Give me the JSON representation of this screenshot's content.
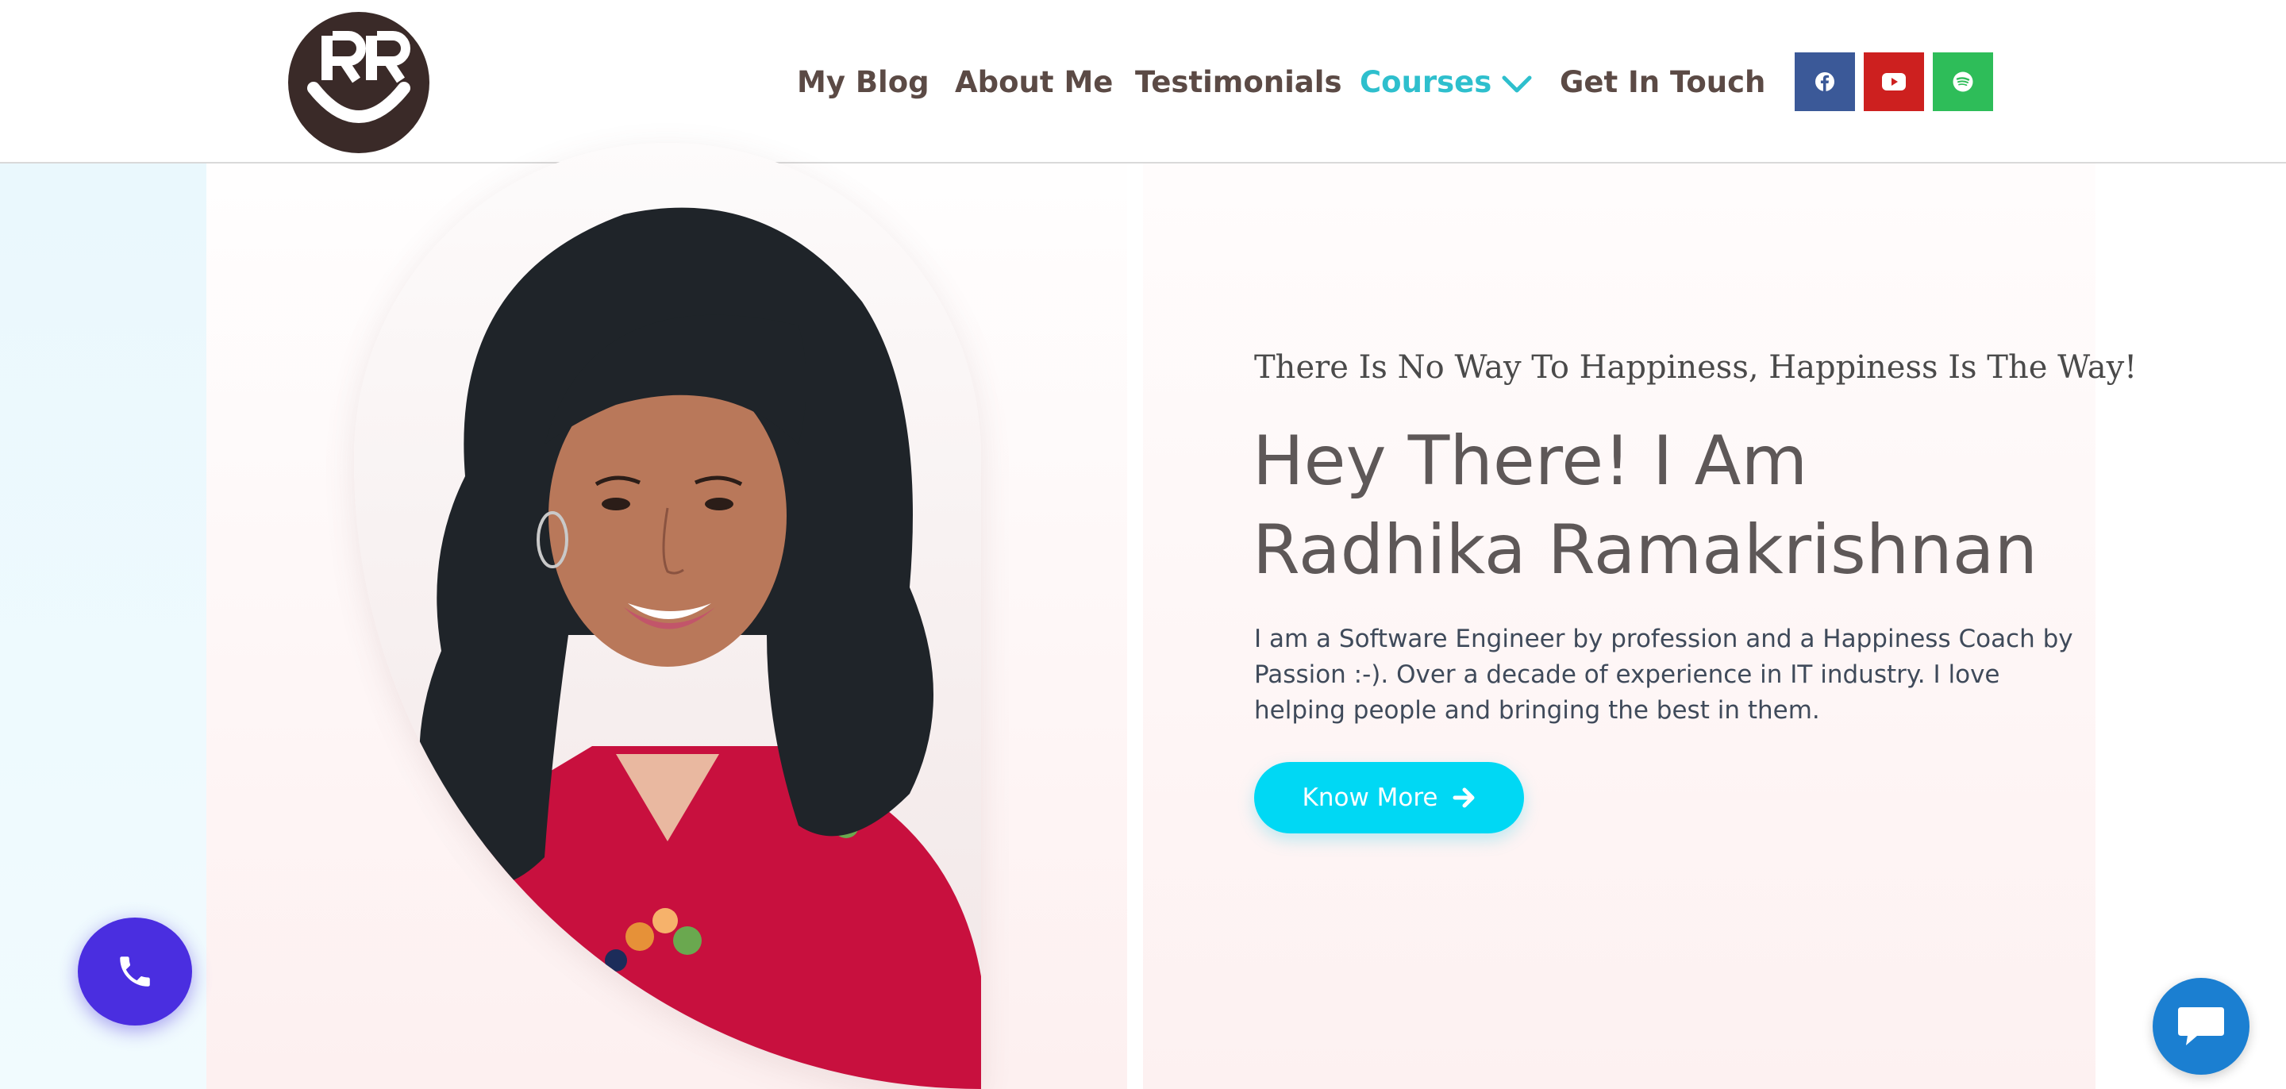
{
  "logo": {
    "name": "site-logo",
    "initials": "RR"
  },
  "nav": {
    "items": [
      {
        "label": "My Blog"
      },
      {
        "label": "About Me"
      },
      {
        "label": "Testimonials"
      },
      {
        "label": "Courses",
        "has_dropdown": true,
        "active": true
      },
      {
        "label": "Get In Touch"
      }
    ]
  },
  "social": [
    {
      "icon": "facebook-icon",
      "color": "#3b5998"
    },
    {
      "icon": "youtube-icon",
      "color": "#cd201f"
    },
    {
      "icon": "spotify-icon",
      "color": "#2ebd59"
    }
  ],
  "hero": {
    "tagline": "There Is No Way To Happiness, Happiness Is The Way!",
    "headline_line1": "Hey There! I Am",
    "headline_line2": "Radhika Ramakrishnan",
    "intro": "I am a Software Engineer by profession and a Happiness Coach by Passion :-). Over a decade of experience in IT industry. I love helping people and bringing the best in them.",
    "cta_label": "Know More"
  },
  "colors": {
    "accent": "#00d8f4",
    "nav_active": "#2ebfcd",
    "nav_text": "#5b4a45",
    "phone_fab": "#4a2ee0",
    "chat_fab": "#1b7fd1"
  }
}
